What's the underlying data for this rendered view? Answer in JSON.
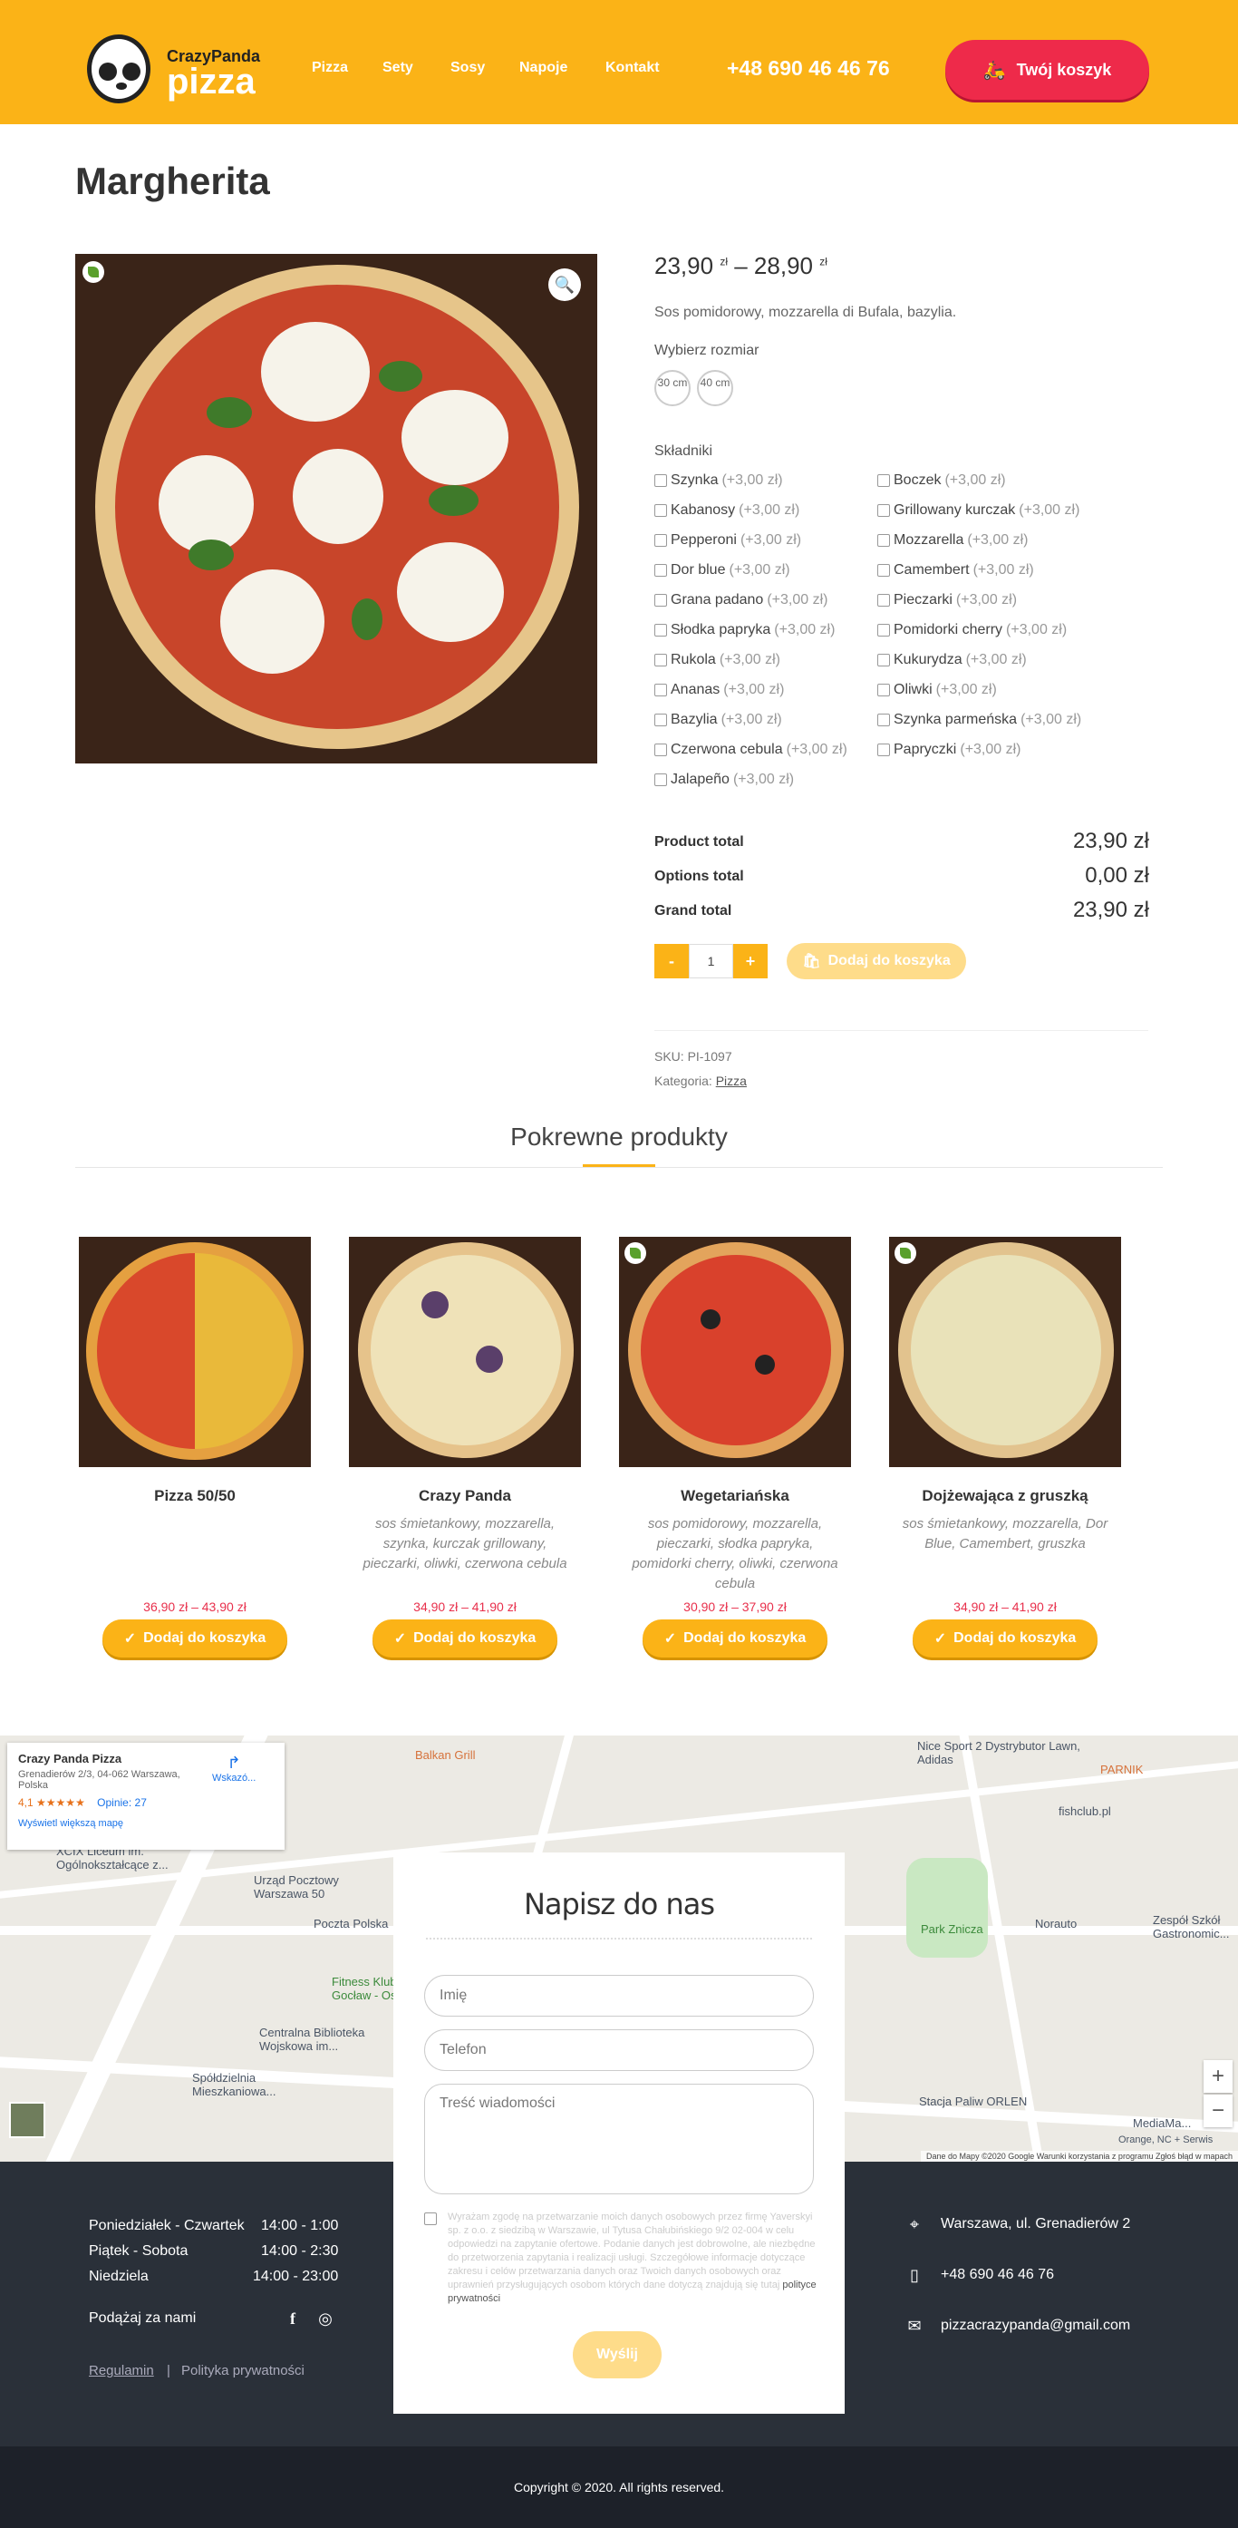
{
  "header": {
    "logo_top": "CrazyPanda",
    "logo_bottom": "pizza",
    "nav": [
      "Pizza",
      "Sety",
      "Sosy",
      "Napoje",
      "Kontakt"
    ],
    "phone": "+48 690 46 46 76",
    "cart_label": "Twój koszyk"
  },
  "product": {
    "title": "Margherita",
    "price_from": "23,90",
    "price_to": "28,90",
    "currency": "zł",
    "price_sep": "–",
    "description": "Sos pomidorowy, mozzarella di Bufala, bazylia.",
    "size_label": "Wybierz rozmiar",
    "sizes": [
      "30 cm",
      "40 cm"
    ],
    "ingredients_label": "Składniki",
    "ingredients_left": [
      {
        "name": "Szynka",
        "extra": "(+3,00 zł)"
      },
      {
        "name": "Kabanosy",
        "extra": "(+3,00 zł)"
      },
      {
        "name": "Pepperoni",
        "extra": "(+3,00 zł)"
      },
      {
        "name": "Dor blue",
        "extra": "(+3,00 zł)"
      },
      {
        "name": "Grana padano",
        "extra": "(+3,00 zł)"
      },
      {
        "name": "Słodka papryka",
        "extra": "(+3,00 zł)"
      },
      {
        "name": "Rukola",
        "extra": "(+3,00 zł)"
      },
      {
        "name": "Ananas",
        "extra": "(+3,00 zł)"
      },
      {
        "name": "Bazylia",
        "extra": "(+3,00 zł)"
      },
      {
        "name": "Czerwona cebula",
        "extra": "(+3,00 zł)"
      },
      {
        "name": "Jalapeño",
        "extra": "(+3,00 zł)"
      }
    ],
    "ingredients_right": [
      {
        "name": "Boczek",
        "extra": "(+3,00 zł)"
      },
      {
        "name": "Grillowany kurczak",
        "extra": "(+3,00 zł)"
      },
      {
        "name": "Mozzarella",
        "extra": "(+3,00 zł)"
      },
      {
        "name": "Camembert",
        "extra": "(+3,00 zł)"
      },
      {
        "name": "Pieczarki",
        "extra": "(+3,00 zł)"
      },
      {
        "name": "Pomidorki cherry",
        "extra": "(+3,00 zł)"
      },
      {
        "name": "Kukurydza",
        "extra": "(+3,00 zł)"
      },
      {
        "name": "Oliwki",
        "extra": "(+3,00 zł)"
      },
      {
        "name": "Szynka parmeńska",
        "extra": "(+3,00 zł)"
      },
      {
        "name": "Papryczki",
        "extra": "(+3,00 zł)"
      }
    ],
    "totals": [
      {
        "label": "Product total",
        "value": "23,90 zł"
      },
      {
        "label": "Options total",
        "value": "0,00 zł"
      },
      {
        "label": "Grand total",
        "value": "23,90 zł"
      }
    ],
    "qty_minus": "-",
    "qty_value": "1",
    "qty_plus": "+",
    "add_to_cart": "Dodaj do koszyka",
    "sku": "SKU: PI-1097",
    "category_label": "Kategoria:",
    "category": "Pizza"
  },
  "related": {
    "title": "Pokrewne produkty",
    "items": [
      {
        "name": "Pizza 50/50",
        "desc": "",
        "price": "36,90 zł – 43,90 zł",
        "button": "Dodaj do koszyka"
      },
      {
        "name": "Crazy Panda",
        "desc": "sos śmietankowy, mozzarella, szynka, kurczak grillowany, pieczarki, oliwki, czerwona cebula",
        "price": "34,90 zł – 41,90 zł",
        "button": "Dodaj do koszyka"
      },
      {
        "name": "Wegetariańska",
        "desc": "sos pomidorowy, mozzarella, pieczarki, słodka papryka, pomidorki cherry, oliwki, czerwona cebula",
        "price": "30,90 zł – 37,90 zł",
        "button": "Dodaj do koszyka"
      },
      {
        "name": "Dojżewająca z gruszką",
        "desc": "sos śmietankowy, mozzarella, Dor Blue, Camembert, gruszka",
        "price": "34,90 zł – 41,90 zł",
        "button": "Dodaj do koszyka"
      }
    ]
  },
  "map": {
    "place_name": "Crazy Panda Pizza",
    "place_address": "Grenadierów 2/3, 04-062 Warszawa, Polska",
    "rating": "4,1",
    "stars": "★★★★★",
    "reviews": "Opinie: 27",
    "directions": "Wskazó...",
    "larger_map": "Wyświetl większą mapę",
    "labels": [
      "Balkan Grill",
      "Nice Sport 2 Dystrybutor Lawn, Adidas",
      "PARNIK",
      "fishclub.pl",
      "XCIX Liceum im. Ogólnokształcące z...",
      "Urząd Pocztowy Warszawa 50",
      "Poczta Polska",
      "Fitness Klub Gocław - Os...",
      "Centralna Biblioteka Wojskowa im...",
      "Spółdzielnia Mieszkaniowa...",
      "Park Znicza",
      "Norauto",
      "Zespół Szkół Gastronomic...",
      "Stacja Paliw ORLEN",
      "MediaMa...",
      "Orange, NC + Serwis"
    ],
    "attribution": "Dane do Mapy ©2020 Google   Warunki korzystania z programu   Zgłoś błąd w mapach",
    "zoom_in": "+",
    "zoom_out": "−"
  },
  "contact_form": {
    "title": "Napisz do nas",
    "name_placeholder": "Imię",
    "phone_placeholder": "Telefon",
    "message_placeholder": "Treść wiadomości",
    "consent": "Wyrażam zgodę na przetwarzanie moich danych osobowych przez firmę Yaverskyi sp. z o.o. z siedzibą w Warszawie, ul Tytusa Chałubińskiego 9/2 02-004 w celu odpowiedzi na zapytanie ofertowe. Podanie danych jest dobrowolne, ale niezbędne do przetworzenia zapytania i realizacji usługi. Szczegółowe informacje dotyczące zakresu i celów przetwarzania danych oraz Twoich danych osobowych oraz uprawnień przysługujących osobom których dane dotyczą znajdują się tutaj",
    "consent_link": "polityce prywatności",
    "submit": "Wyślij"
  },
  "footer": {
    "hours": [
      {
        "day": "Poniedziałek - Czwartek",
        "time": "14:00 - 1:00"
      },
      {
        "day": "Piątek - Sobota",
        "time": "14:00 - 2:30"
      },
      {
        "day": "Niedziela",
        "time": "14:00 - 23:00"
      }
    ],
    "follow": "Podążaj za nami",
    "links": [
      "Regulamin",
      "Polityka prywatności"
    ],
    "address": "Warszawa, ul. Grenadierów 2",
    "phone": "+48 690 46 46 76",
    "email": "pizzacrazypanda@gmail.com",
    "copyright": "Copyright © 2020. All rights reserved."
  }
}
